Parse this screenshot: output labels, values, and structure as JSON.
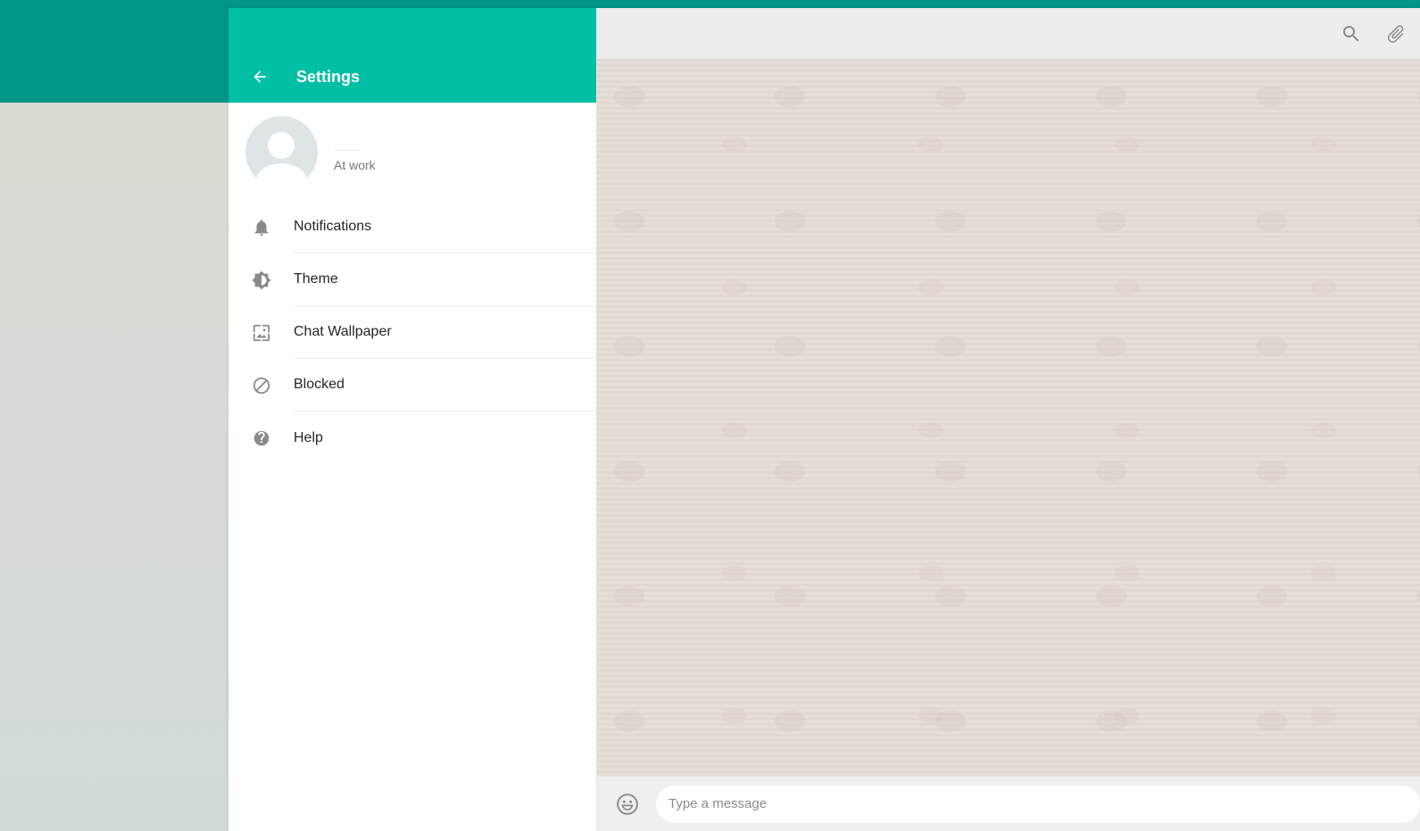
{
  "colors": {
    "top_band": "#009688",
    "drawer_header": "#00bfa5",
    "chat_background": "#e5ddd5",
    "icon_gray": "#8a8a8a"
  },
  "drawer": {
    "title": "Settings",
    "back_icon": "arrow-left-icon",
    "profile": {
      "avatar_icon": "default-avatar-icon",
      "status": "At work"
    },
    "menu": [
      {
        "label": "Notifications",
        "icon": "bell-icon"
      },
      {
        "label": "Theme",
        "icon": "brightness-icon"
      },
      {
        "label": "Chat Wallpaper",
        "icon": "wallpaper-icon"
      },
      {
        "label": "Blocked",
        "icon": "block-icon"
      },
      {
        "label": "Help",
        "icon": "help-icon"
      }
    ]
  },
  "chat": {
    "header_icons": [
      "search-icon",
      "paperclip-icon"
    ],
    "composer": {
      "emoji_icon": "emoji-icon",
      "placeholder": "Type a message",
      "value": ""
    }
  }
}
